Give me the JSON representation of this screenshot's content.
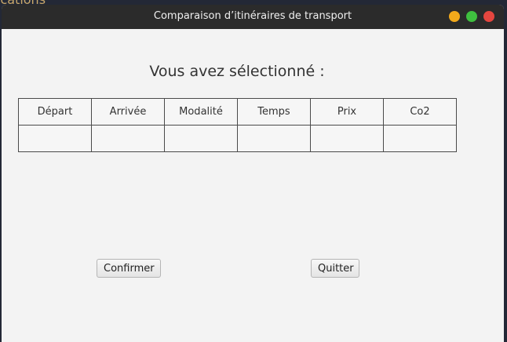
{
  "background": {
    "partial_text": "ications"
  },
  "window": {
    "title": "Comparaison d’itinéraires de transport"
  },
  "main": {
    "heading": "Vous avez sélectionné :",
    "table": {
      "headers": [
        "Départ",
        "Arrivée",
        "Modalité",
        "Temps",
        "Prix",
        "Co2"
      ],
      "rows": [
        [
          "",
          "",
          "",
          "",
          "",
          ""
        ]
      ]
    }
  },
  "buttons": {
    "confirm_label": "Confirmer",
    "quit_label": "Quitter"
  },
  "colors": {
    "minimize": "#f2a91b",
    "maximize": "#3fbf3f",
    "close": "#e5463f",
    "titlebar": "#2b2b2b"
  }
}
